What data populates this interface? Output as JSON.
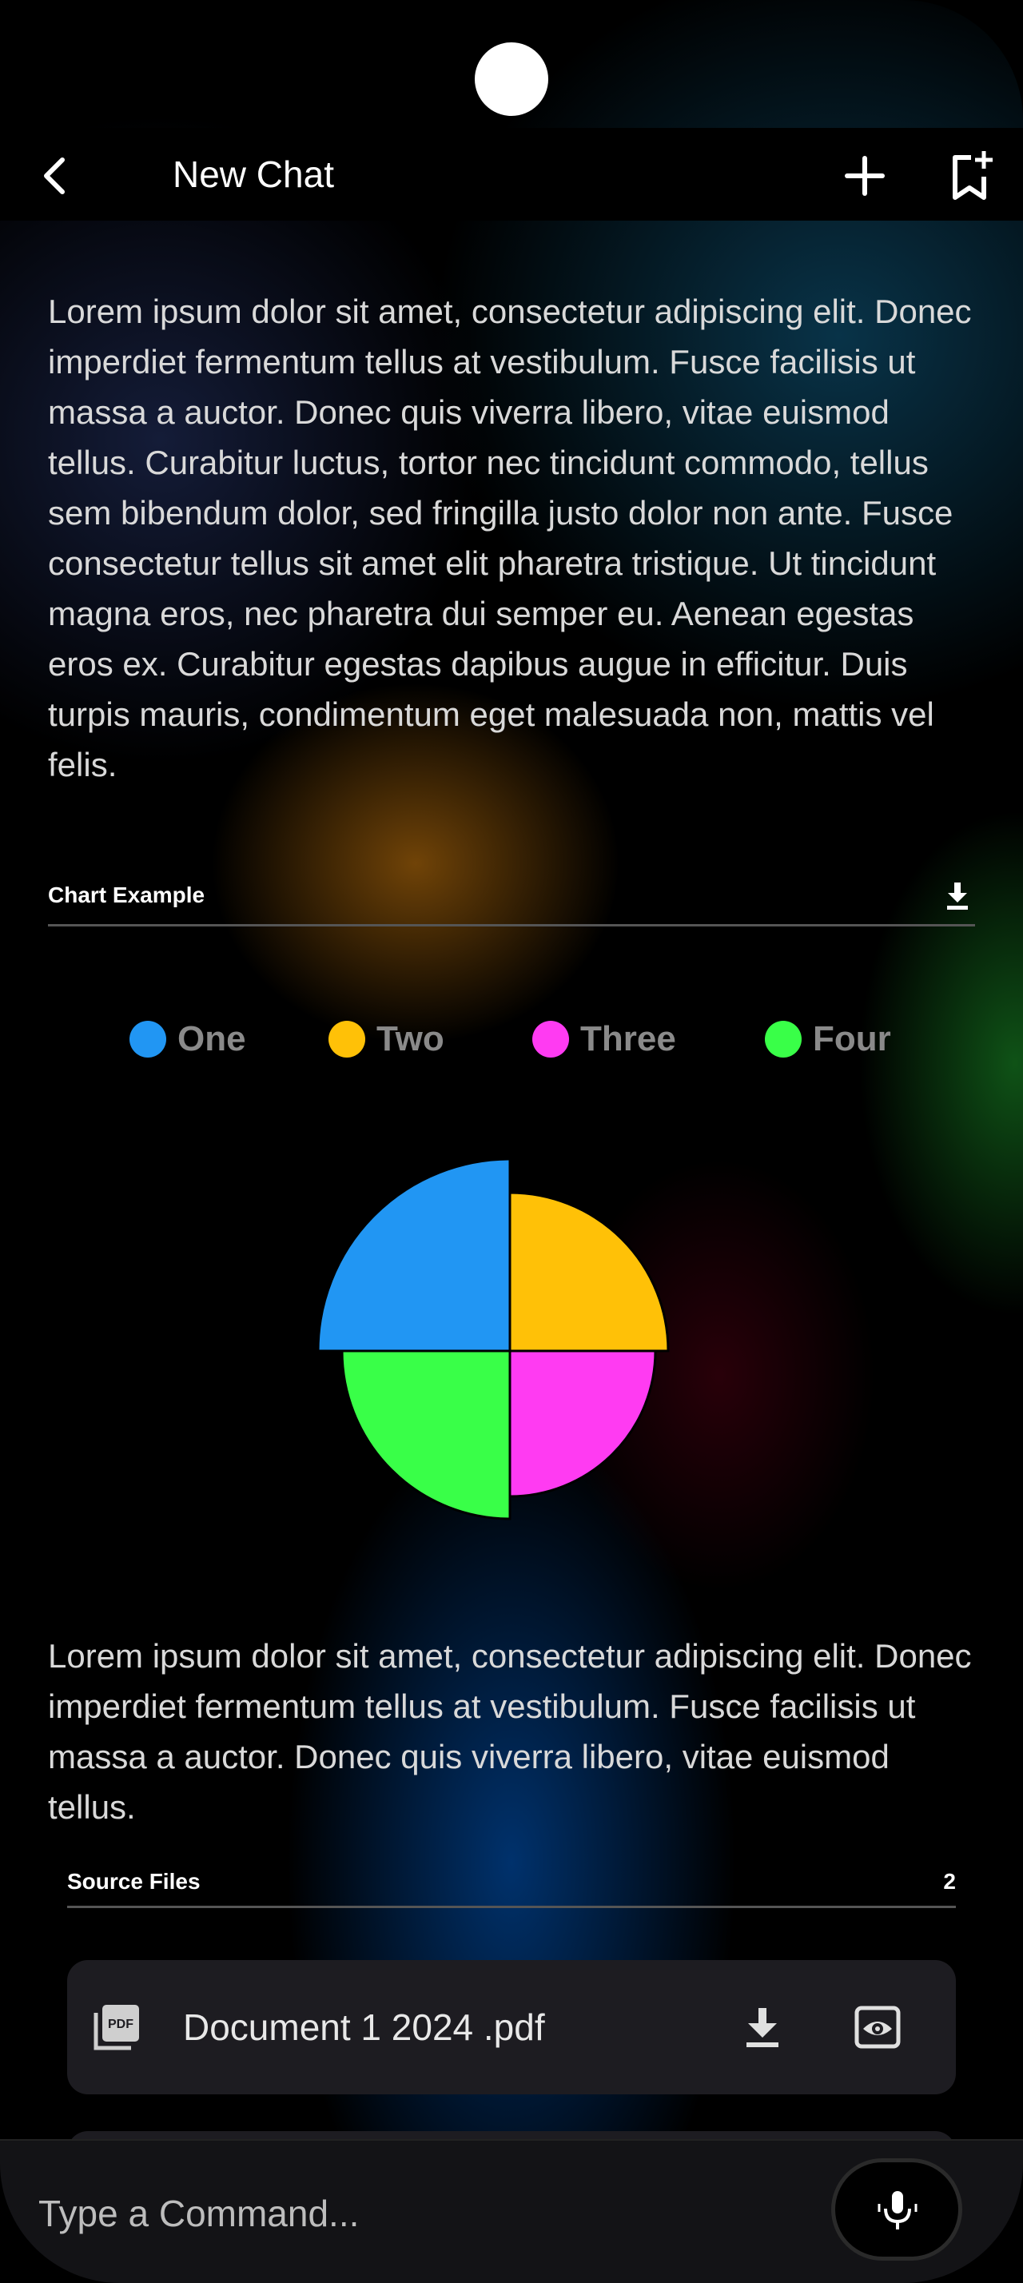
{
  "header": {
    "title": "New Chat",
    "back_icon": "chevron-left-icon",
    "plus_icon": "plus-icon",
    "bookmark_icon": "bookmark-add-icon"
  },
  "messages": {
    "paragraph1": "Lorem ipsum dolor sit amet, consectetur adipiscing elit. Donec imperdiet fermentum tellus at vestibulum. Fusce facilisis ut massa a auctor. Donec quis viverra libero, vitae euismod tellus. Curabitur luctus, tortor nec tincidunt commodo, tellus sem bibendum dolor, sed fringilla justo dolor non ante. Fusce consectetur tellus sit amet elit pharetra tristique. Ut tincidunt magna eros, nec pharetra dui semper eu. Aenean egestas eros ex. Curabitur egestas dapibus augue in efficitur. Duis turpis mauris, condimentum eget malesuada non, mattis vel felis.",
    "paragraph2": "Lorem ipsum dolor sit amet, consectetur adipiscing elit. Donec imperdiet fermentum tellus at vestibulum. Fusce facilisis ut massa a auctor. Donec quis viverra libero, vitae euismod tellus."
  },
  "chart_section": {
    "label": "Chart Example",
    "download_icon": "download-icon"
  },
  "chart_data": {
    "type": "pie",
    "categories": [
      "One",
      "Two",
      "Three",
      "Four"
    ],
    "values": [
      25,
      25,
      25,
      25
    ],
    "colors": [
      "#2196F3",
      "#FFC107",
      "#FF3BF2",
      "#39FF48"
    ],
    "legend_placement": "top"
  },
  "sources": {
    "label": "Source Files",
    "count": "2",
    "files": [
      {
        "name": "Document 1 2024 .pdf",
        "icon": "pdf-icon"
      }
    ]
  },
  "composer": {
    "placeholder": "Type a Command...",
    "mic_icon": "microphone-icon"
  }
}
